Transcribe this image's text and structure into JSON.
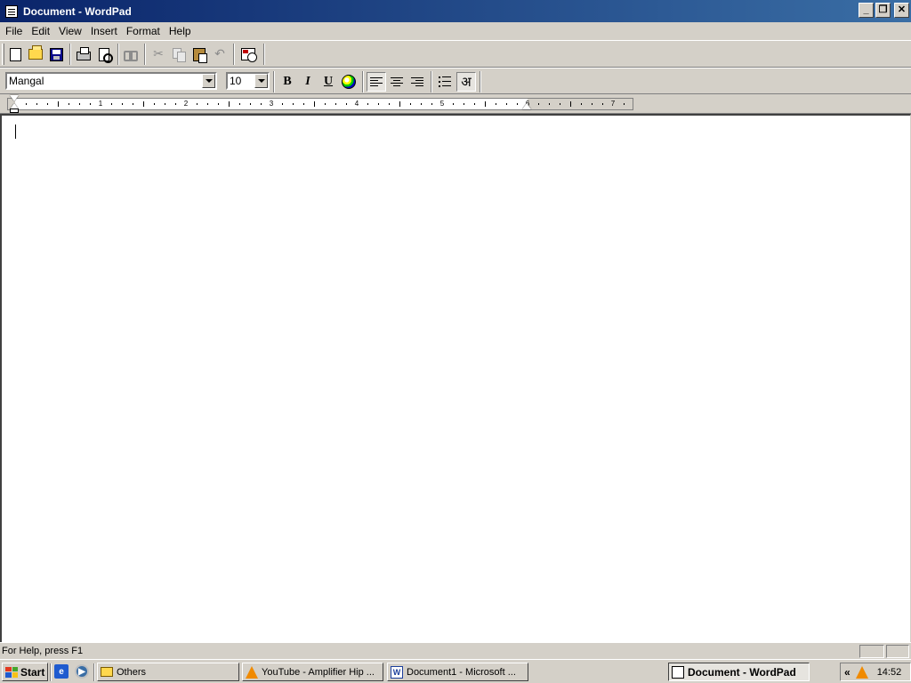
{
  "window": {
    "title": "Document - WordPad",
    "controls": {
      "minimize": "_",
      "restore": "❐",
      "close": "✕"
    }
  },
  "menubar": {
    "items": [
      "File",
      "Edit",
      "View",
      "Insert",
      "Format",
      "Help"
    ]
  },
  "toolbar": {
    "buttons": [
      {
        "name": "new",
        "icon": "new-document-icon",
        "enabled": true
      },
      {
        "name": "open",
        "icon": "open-folder-icon",
        "enabled": true
      },
      {
        "name": "save",
        "icon": "save-disk-icon",
        "enabled": true
      },
      {
        "name": "print",
        "icon": "printer-icon",
        "enabled": true
      },
      {
        "name": "print-preview",
        "icon": "print-preview-icon",
        "enabled": true
      },
      {
        "name": "find",
        "icon": "binoculars-icon",
        "enabled": false
      },
      {
        "name": "cut",
        "icon": "scissors-icon",
        "enabled": false
      },
      {
        "name": "copy",
        "icon": "copy-icon",
        "enabled": false
      },
      {
        "name": "paste",
        "icon": "paste-icon",
        "enabled": true
      },
      {
        "name": "undo",
        "icon": "undo-icon",
        "enabled": false
      },
      {
        "name": "date-time",
        "icon": "date-time-icon",
        "enabled": true
      }
    ]
  },
  "format_bar": {
    "font": "Mangal",
    "font_size": "10",
    "bold_label": "B",
    "italic_label": "I",
    "underline_label": "U",
    "color_icon": "color-palette-icon",
    "align_left_pressed": true,
    "rtl_glyph": "अ"
  },
  "ruler": {
    "numbers": [
      "1",
      "2",
      "3",
      "4",
      "5",
      "6",
      "7"
    ]
  },
  "statusbar": {
    "help_text": "For Help, press F1"
  },
  "taskbar": {
    "start_label": "Start",
    "tasks": [
      {
        "label": "Others",
        "icon": "folder-icon"
      },
      {
        "label": "YouTube - Amplifier Hip ...",
        "icon": "vlc-icon"
      },
      {
        "label": "Document1 - Microsoft ...",
        "icon": "word-icon"
      },
      {
        "label": "Document - WordPad",
        "icon": "wordpad-icon",
        "active": true
      }
    ],
    "tray_chevron": "«",
    "clock": "14:52"
  }
}
